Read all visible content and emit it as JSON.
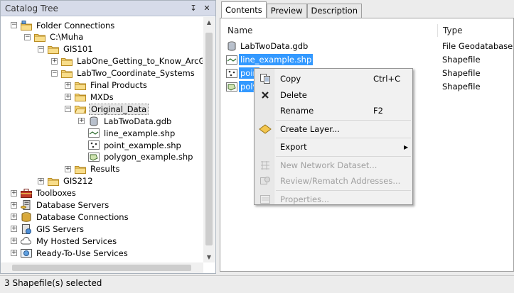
{
  "catalog": {
    "title": "Catalog Tree",
    "pin_glyph": "↧",
    "close_glyph": "✕",
    "tree": [
      {
        "label": "Folder Connections",
        "icon": "folder-connections-icon",
        "depth": 0,
        "expander": "minus"
      },
      {
        "label": "C:\\Muha",
        "icon": "folder-icon",
        "depth": 1,
        "expander": "minus"
      },
      {
        "label": "GIS101",
        "icon": "folder-icon",
        "depth": 2,
        "expander": "minus"
      },
      {
        "label": "LabOne_Getting_to_Know_ArcGIS",
        "icon": "folder-icon",
        "depth": 3,
        "expander": "plus"
      },
      {
        "label": "LabTwo_Coordinate_Systems",
        "icon": "folder-icon",
        "depth": 3,
        "expander": "minus"
      },
      {
        "label": "Final Products",
        "icon": "folder-icon",
        "depth": 4,
        "expander": "plus"
      },
      {
        "label": "MXDs",
        "icon": "folder-icon",
        "depth": 4,
        "expander": "plus"
      },
      {
        "label": "Original_Data",
        "icon": "folder-open-icon",
        "depth": 4,
        "expander": "minus",
        "selected": true
      },
      {
        "label": "LabTwoData.gdb",
        "icon": "geodatabase-icon",
        "depth": 5,
        "expander": "plus"
      },
      {
        "label": "line_example.shp",
        "icon": "line-shapefile-icon",
        "depth": 5,
        "expander": "none"
      },
      {
        "label": "point_example.shp",
        "icon": "point-shapefile-icon",
        "depth": 5,
        "expander": "none"
      },
      {
        "label": "polygon_example.shp",
        "icon": "polygon-shapefile-icon",
        "depth": 5,
        "expander": "none"
      },
      {
        "label": "Results",
        "icon": "folder-icon",
        "depth": 4,
        "expander": "plus"
      },
      {
        "label": "GIS212",
        "icon": "folder-icon",
        "depth": 2,
        "expander": "plus"
      },
      {
        "label": "Toolboxes",
        "icon": "toolbox-icon",
        "depth": 0,
        "expander": "plus"
      },
      {
        "label": "Database Servers",
        "icon": "database-server-icon",
        "depth": 0,
        "expander": "plus"
      },
      {
        "label": "Database Connections",
        "icon": "database-connection-icon",
        "depth": 0,
        "expander": "plus"
      },
      {
        "label": "GIS Servers",
        "icon": "gis-server-icon",
        "depth": 0,
        "expander": "plus"
      },
      {
        "label": "My Hosted Services",
        "icon": "hosted-services-icon",
        "depth": 0,
        "expander": "plus"
      },
      {
        "label": "Ready-To-Use Services",
        "icon": "ready-services-icon",
        "depth": 0,
        "expander": "plus"
      }
    ]
  },
  "tabs": [
    {
      "label": "Contents",
      "active": true
    },
    {
      "label": "Preview",
      "active": false
    },
    {
      "label": "Description",
      "active": false
    }
  ],
  "columns": {
    "name": "Name",
    "type": "Type"
  },
  "files": [
    {
      "name": "LabTwoData.gdb",
      "type": "File Geodatabase",
      "icon": "geodatabase-icon",
      "selected": false
    },
    {
      "name": "line_example.shp",
      "type": "Shapefile",
      "icon": "line-shapefile-icon",
      "selected": true
    },
    {
      "name": "poin",
      "type": "Shapefile",
      "icon": "point-shapefile-icon",
      "selected": true
    },
    {
      "name": "poly",
      "type": "Shapefile",
      "icon": "polygon-shapefile-icon",
      "selected": true
    }
  ],
  "context_menu": {
    "items": [
      {
        "label": "Copy",
        "shortcut": "Ctrl+C",
        "icon": "copy-icon",
        "enabled": true
      },
      {
        "label": "Delete",
        "shortcut": "",
        "icon": "delete-icon",
        "enabled": true
      },
      {
        "label": "Rename",
        "shortcut": "F2",
        "icon": "",
        "enabled": true
      },
      {
        "separator": true
      },
      {
        "label": "Create Layer...",
        "shortcut": "",
        "icon": "create-layer-icon",
        "enabled": true
      },
      {
        "separator": true
      },
      {
        "label": "Export",
        "shortcut": "",
        "icon": "",
        "enabled": true,
        "submenu": true
      },
      {
        "separator": true
      },
      {
        "label": "New Network Dataset...",
        "shortcut": "",
        "icon": "network-dataset-icon",
        "enabled": false
      },
      {
        "label": "Review/Rematch Addresses...",
        "shortcut": "",
        "icon": "rematch-icon",
        "enabled": false
      },
      {
        "separator": true
      },
      {
        "label": "Properties...",
        "shortcut": "",
        "icon": "properties-icon",
        "enabled": false
      }
    ]
  },
  "status": {
    "text": "3 Shapefile(s) selected"
  }
}
